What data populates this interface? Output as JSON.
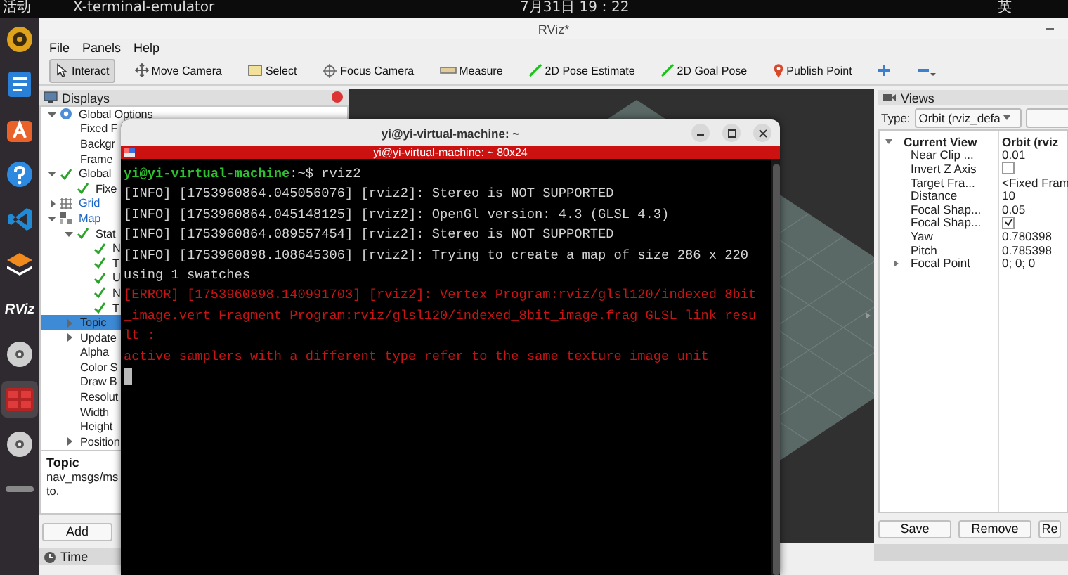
{
  "top_bar": {
    "activities": "活动",
    "app": "X-terminal-emulator",
    "clock": "7月31日  19：22",
    "input_method": "英"
  },
  "dock": [
    {
      "kind": "speaker",
      "selected": false
    },
    {
      "kind": "document",
      "selected": false
    },
    {
      "kind": "store",
      "selected": false
    },
    {
      "kind": "help",
      "selected": false
    },
    {
      "kind": "code",
      "selected": false
    },
    {
      "kind": "stack",
      "selected": false
    },
    {
      "kind": "rviz",
      "label": "RViz",
      "selected": false
    },
    {
      "kind": "disc",
      "selected": false
    },
    {
      "kind": "terminal",
      "selected": true
    },
    {
      "kind": "disc",
      "selected": false
    },
    {
      "kind": "bar",
      "selected": false
    }
  ],
  "rviz": {
    "title": "RViz*",
    "menu": [
      "File",
      "Panels",
      "Help"
    ],
    "tools": [
      {
        "kind": "interact",
        "label": "Interact",
        "selected": true
      },
      {
        "kind": "move",
        "label": "Move Camera",
        "selected": false
      },
      {
        "kind": "select",
        "label": "Select",
        "selected": false
      },
      {
        "kind": "focus",
        "label": "Focus Camera",
        "selected": false
      },
      {
        "kind": "measure",
        "label": "Measure",
        "selected": false
      },
      {
        "kind": "pose",
        "label": "2D Pose Estimate",
        "selected": false
      },
      {
        "kind": "goal",
        "label": "2D Goal Pose",
        "selected": false
      },
      {
        "kind": "publish",
        "label": "Publish Point",
        "selected": false
      },
      {
        "kind": "add",
        "selected": false
      },
      {
        "kind": "remove",
        "selected": false
      }
    ],
    "displays": {
      "title": "Displays",
      "tree": [
        {
          "label": "Global Options",
          "kind": "options",
          "expanded": true,
          "selected": false,
          "children": [
            {
              "label": "Fixed F",
              "kind": "property",
              "selected": false
            },
            {
              "label": "Backgr",
              "kind": "property",
              "selected": false
            },
            {
              "label": "Frame",
              "kind": "property",
              "selected": false
            }
          ]
        },
        {
          "label": "Global",
          "kind": "status",
          "expanded": true,
          "selected": false,
          "children": [
            {
              "label": "Fixe",
              "kind": "status",
              "selected": false
            }
          ]
        },
        {
          "label": "Grid",
          "kind": "grid",
          "expanded": false,
          "selected": false
        },
        {
          "label": "Map",
          "kind": "map",
          "expanded": true,
          "selected": false,
          "children": [
            {
              "label": "Stat",
              "kind": "status",
              "expanded": true,
              "selected": false,
              "children": [
                {
                  "label": "N",
                  "kind": "status",
                  "selected": false
                },
                {
                  "label": "T",
                  "kind": "status",
                  "selected": false
                },
                {
                  "label": "U",
                  "kind": "status",
                  "selected": false
                },
                {
                  "label": "N",
                  "kind": "status",
                  "selected": false
                },
                {
                  "label": "T",
                  "kind": "status",
                  "selected": false
                }
              ]
            },
            {
              "label": "Topic",
              "kind": "property",
              "expanded": false,
              "selected": true
            },
            {
              "label": "Update",
              "kind": "property",
              "expanded": false,
              "selected": false
            },
            {
              "label": "Alpha",
              "kind": "property",
              "selected": false
            },
            {
              "label": "Color S",
              "kind": "property",
              "selected": false
            },
            {
              "label": "Draw B",
              "kind": "property",
              "selected": false
            },
            {
              "label": "Resolut",
              "kind": "property",
              "selected": false
            },
            {
              "label": "Width",
              "kind": "property",
              "selected": false
            },
            {
              "label": "Height",
              "kind": "property",
              "selected": false
            },
            {
              "label": "Position",
              "kind": "property",
              "expanded": false,
              "selected": false
            }
          ]
        }
      ]
    },
    "description": {
      "title": "Topic",
      "lines": [
        "nav_msgs/ms",
        "to."
      ]
    },
    "add_button": "Add",
    "time_panel": {
      "title": "Time"
    },
    "views": {
      "title": "Views",
      "type_label": "Type:",
      "type_value": "Orbit (rviz_defa",
      "rows": [
        {
          "kind": "group",
          "name": "Current View",
          "value": "Orbit (rviz",
          "expanded": true
        },
        {
          "kind": "text",
          "name": "Near Clip ...",
          "value": "0.01"
        },
        {
          "kind": "checkbox",
          "name": "Invert Z Axis",
          "checked": false
        },
        {
          "kind": "text",
          "name": "Target Fra...",
          "value": "<Fixed Fram"
        },
        {
          "kind": "text",
          "name": "Distance",
          "value": "10"
        },
        {
          "kind": "text",
          "name": "Focal Shap...",
          "value": "0.05"
        },
        {
          "kind": "checkbox",
          "name": "Focal Shap...",
          "checked": true
        },
        {
          "kind": "text",
          "name": "Yaw",
          "value": "0.780398"
        },
        {
          "kind": "text",
          "name": "Pitch",
          "value": "0.785398"
        },
        {
          "kind": "group",
          "name": "Focal Point",
          "value": "0; 0; 0",
          "expanded": false
        }
      ],
      "buttons": [
        "Save",
        "Remove",
        "Re"
      ]
    }
  },
  "terminal": {
    "title": "yi@yi-virtual-machine: ~",
    "subtitle": "yi@yi-virtual-machine: ~ 80x24",
    "lines": [
      {
        "kind": "prompt",
        "user": "yi@yi-virtual-machine",
        "text": ":~$ rviz2"
      },
      {
        "kind": "info",
        "text": "[INFO] [1753960864.045056076] [rviz2]: Stereo is NOT SUPPORTED"
      },
      {
        "kind": "info",
        "text": "[INFO] [1753960864.045148125] [rviz2]: OpenGl version: 4.3 (GLSL 4.3)"
      },
      {
        "kind": "info",
        "text": "[INFO] [1753960864.089557454] [rviz2]: Stereo is NOT SUPPORTED"
      },
      {
        "kind": "info",
        "text": "[INFO] [1753960898.108645306] [rviz2]: Trying to create a map of size 286 x 220"
      },
      {
        "kind": "info",
        "text": "using 1 swatches"
      },
      {
        "kind": "error",
        "text": "[ERROR] [1753960898.140991703] [rviz2]: Vertex Program:rviz/glsl120/indexed_8bit"
      },
      {
        "kind": "error",
        "text": "_image.vert Fragment Program:rviz/glsl120/indexed_8bit_image.frag GLSL link resu"
      },
      {
        "kind": "error",
        "text": "lt :"
      },
      {
        "kind": "error",
        "text": "active samplers with a different type refer to the same texture image unit"
      }
    ]
  }
}
